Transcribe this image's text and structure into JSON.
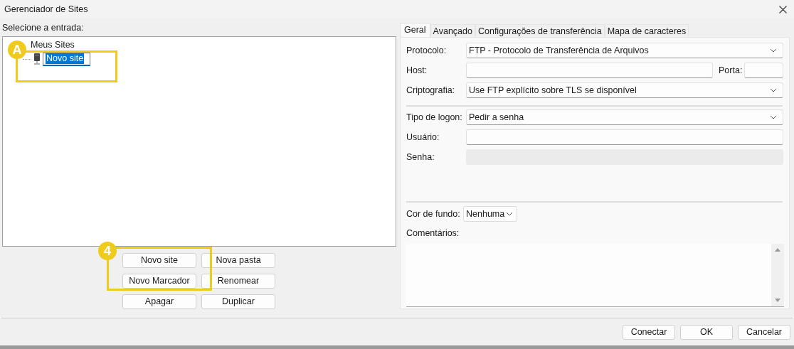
{
  "window": {
    "title": "Gerenciador de Sites"
  },
  "tree": {
    "label": "Selecione a entrada:",
    "items": [
      {
        "label": "Meus Sites",
        "kind": "folder",
        "children": [
          {
            "label": "Novo site",
            "kind": "site",
            "editing": true
          }
        ]
      }
    ]
  },
  "tree_buttons": [
    "Novo site",
    "Nova pasta",
    "Novo Marcador",
    "Renomear",
    "Apagar",
    "Duplicar"
  ],
  "tabs": [
    {
      "label": "Geral",
      "selected": true
    },
    {
      "label": "Avançado",
      "selected": false
    },
    {
      "label": "Configurações de transferência",
      "selected": false
    },
    {
      "label": "Mapa de caracteres",
      "selected": false
    }
  ],
  "sections": [
    [
      {
        "label": "Protocolo:",
        "kind": "select",
        "value": "FTP - Protocolo de Transferência de Arquivos"
      },
      {
        "label": "Host:",
        "kind": "host",
        "port_label": "Porta:"
      },
      {
        "label": "Criptografia:",
        "kind": "select",
        "value": "Use FTP explícito sobre TLS se disponível"
      }
    ],
    [
      {
        "label": "Tipo de logon:",
        "kind": "select",
        "value": "Pedir a senha"
      },
      {
        "label": "Usuário:",
        "kind": "input"
      },
      {
        "label": "Senha:",
        "kind": "disabled"
      }
    ]
  ],
  "background_color": {
    "label": "Cor de fundo:",
    "value": "Nenhuma"
  },
  "comments": {
    "label": "Comentários:"
  },
  "dialog_buttons": [
    "Conectar",
    "OK",
    "Cancelar"
  ],
  "annotations": [
    {
      "label": "A"
    },
    {
      "label": "4"
    }
  ]
}
